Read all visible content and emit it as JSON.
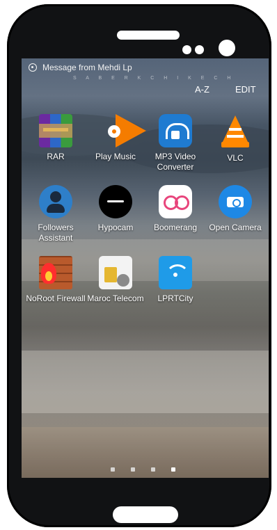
{
  "notification": {
    "text": "Message from Mehdi Lp",
    "icon": "whatsapp-icon"
  },
  "watermark": {
    "text": "S A B E R   K C H I K E C H"
  },
  "top_actions": {
    "sort_label": "A-Z",
    "edit_label": "EDIT"
  },
  "apps": [
    {
      "label": "RAR",
      "icon": "rar-icon"
    },
    {
      "label": "Play Music",
      "icon": "play-music-icon"
    },
    {
      "label": "MP3 Video Converter",
      "icon": "mp3-video-converter-icon"
    },
    {
      "label": "VLC",
      "icon": "vlc-icon"
    },
    {
      "label": "Followers Assistant",
      "icon": "followers-assistant-icon"
    },
    {
      "label": "Hypocam",
      "icon": "hypocam-icon"
    },
    {
      "label": "Boomerang",
      "icon": "boomerang-icon"
    },
    {
      "label": "Open Camera",
      "icon": "open-camera-icon"
    },
    {
      "label": "NoRoot Firewall",
      "icon": "noroot-firewall-icon"
    },
    {
      "label": "Maroc Telecom",
      "icon": "maroc-telecom-icon"
    },
    {
      "label": "LPRTCity",
      "icon": "lprtcity-icon"
    }
  ],
  "pagination": {
    "pages": 4,
    "current_page": 4
  }
}
